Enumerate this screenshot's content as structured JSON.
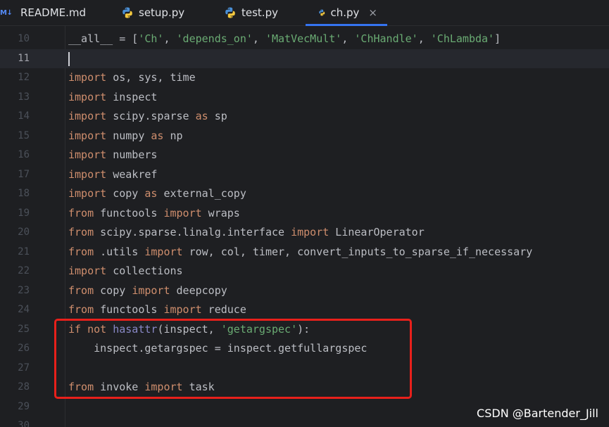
{
  "tabs": [
    {
      "label": "README.md",
      "icon": "markdown-icon",
      "icon_text": "M↓",
      "active": false
    },
    {
      "label": "setup.py",
      "icon": "python-icon",
      "active": false
    },
    {
      "label": "test.py",
      "icon": "python-icon",
      "active": false
    },
    {
      "label": "ch.py",
      "icon": "python-icon",
      "active": true,
      "close": "×"
    }
  ],
  "editor": {
    "current_line": 11,
    "lines": [
      {
        "n": "10",
        "parts": [
          [
            "plain",
            "__all__ = ["
          ],
          [
            "str",
            "'Ch'"
          ],
          [
            "plain",
            ", "
          ],
          [
            "str",
            "'depends_on'"
          ],
          [
            "plain",
            ", "
          ],
          [
            "str",
            "'MatVecMult'"
          ],
          [
            "plain",
            ", "
          ],
          [
            "str",
            "'ChHandle'"
          ],
          [
            "plain",
            ", "
          ],
          [
            "str",
            "'ChLambda'"
          ],
          [
            "plain",
            "]"
          ]
        ]
      },
      {
        "n": "11",
        "parts": []
      },
      {
        "n": "12",
        "parts": [
          [
            "kw",
            "import"
          ],
          [
            "plain",
            " os, sys, time"
          ]
        ]
      },
      {
        "n": "13",
        "parts": [
          [
            "kw",
            "import"
          ],
          [
            "plain",
            " inspect"
          ]
        ]
      },
      {
        "n": "14",
        "parts": [
          [
            "kw",
            "import"
          ],
          [
            "plain",
            " scipy.sparse "
          ],
          [
            "kw",
            "as"
          ],
          [
            "plain",
            " sp"
          ]
        ]
      },
      {
        "n": "15",
        "parts": [
          [
            "kw",
            "import"
          ],
          [
            "plain",
            " numpy "
          ],
          [
            "kw",
            "as"
          ],
          [
            "plain",
            " np"
          ]
        ]
      },
      {
        "n": "16",
        "parts": [
          [
            "kw",
            "import"
          ],
          [
            "plain",
            " numbers"
          ]
        ]
      },
      {
        "n": "17",
        "parts": [
          [
            "kw",
            "import"
          ],
          [
            "plain",
            " weakref"
          ]
        ]
      },
      {
        "n": "18",
        "parts": [
          [
            "kw",
            "import"
          ],
          [
            "plain",
            " copy "
          ],
          [
            "kw",
            "as"
          ],
          [
            "plain",
            " external_copy"
          ]
        ]
      },
      {
        "n": "19",
        "parts": [
          [
            "kw",
            "from"
          ],
          [
            "plain",
            " functools "
          ],
          [
            "kw",
            "import"
          ],
          [
            "plain",
            " wraps"
          ]
        ]
      },
      {
        "n": "20",
        "parts": [
          [
            "kw",
            "from"
          ],
          [
            "plain",
            " scipy.sparse.linalg.interface "
          ],
          [
            "kw",
            "import"
          ],
          [
            "plain",
            " LinearOperator"
          ]
        ]
      },
      {
        "n": "21",
        "parts": [
          [
            "kw",
            "from"
          ],
          [
            "plain",
            " .utils "
          ],
          [
            "kw",
            "import"
          ],
          [
            "plain",
            " row, col, timer, convert_inputs_to_sparse_if_necessary"
          ]
        ]
      },
      {
        "n": "22",
        "parts": [
          [
            "kw",
            "import"
          ],
          [
            "plain",
            " collections"
          ]
        ]
      },
      {
        "n": "23",
        "parts": [
          [
            "kw",
            "from"
          ],
          [
            "plain",
            " copy "
          ],
          [
            "kw",
            "import"
          ],
          [
            "plain",
            " deepcopy"
          ]
        ]
      },
      {
        "n": "24",
        "parts": [
          [
            "kw",
            "from"
          ],
          [
            "plain",
            " functools "
          ],
          [
            "kw",
            "import"
          ],
          [
            "plain",
            " reduce"
          ]
        ]
      },
      {
        "n": "25",
        "parts": [
          [
            "kw",
            "if"
          ],
          [
            "plain",
            " "
          ],
          [
            "kw",
            "not"
          ],
          [
            "plain",
            " "
          ],
          [
            "bi",
            "hasattr"
          ],
          [
            "plain",
            "(inspect, "
          ],
          [
            "str",
            "'getargspec'"
          ],
          [
            "plain",
            "):"
          ]
        ]
      },
      {
        "n": "26",
        "parts": [
          [
            "plain",
            "    inspect.getargspec = inspect.getfullargspec"
          ]
        ]
      },
      {
        "n": "27",
        "parts": []
      },
      {
        "n": "28",
        "parts": [
          [
            "kw",
            "from"
          ],
          [
            "plain",
            " invoke "
          ],
          [
            "kw",
            "import"
          ],
          [
            "plain",
            " task"
          ]
        ]
      },
      {
        "n": "29",
        "parts": []
      },
      {
        "n": "30",
        "parts": []
      }
    ]
  },
  "colors": {
    "background": "#1e1f22",
    "keyword": "#cf8e6d",
    "string": "#6aab73",
    "builtin": "#8888c6",
    "highlight_box": "#e8201b",
    "active_tab_underline": "#3574f0"
  },
  "watermark": "CSDN @Bartender_Jill"
}
